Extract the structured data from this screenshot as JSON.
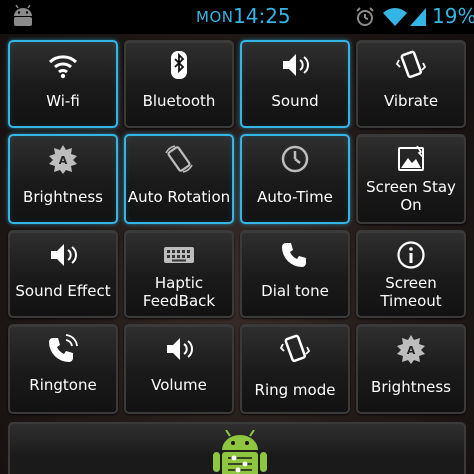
{
  "status_bar": {
    "day": "MON",
    "time": "14:25",
    "battery_percent": "19%",
    "accent_color": "#33b5e5",
    "icons": [
      "android-icon",
      "alarm-icon",
      "wifi-icon",
      "signal-icon"
    ]
  },
  "tiles": [
    {
      "label": "Wi-fi",
      "icon": "wifi-icon",
      "active": true
    },
    {
      "label": "Bluetooth",
      "icon": "bluetooth-icon",
      "active": false
    },
    {
      "label": "Sound",
      "icon": "speaker-icon",
      "active": true
    },
    {
      "label": "Vibrate",
      "icon": "vibrate-icon",
      "active": false
    },
    {
      "label": "Brightness",
      "icon": "brightness-icon",
      "active": true
    },
    {
      "label": "Auto Rotation",
      "icon": "rotate-icon",
      "active": true
    },
    {
      "label": "Auto-Time",
      "icon": "clock-icon",
      "active": true
    },
    {
      "label_line1": "Screen Stay",
      "label_line2": "On",
      "icon": "screen-stay-on-icon",
      "active": false
    },
    {
      "label": "Sound Effect",
      "icon": "speaker-icon",
      "active": false
    },
    {
      "label_line1": "Haptic",
      "label_line2": "FeedBack",
      "icon": "keyboard-icon",
      "active": false
    },
    {
      "label": "Dial tone",
      "icon": "phone-icon",
      "active": false
    },
    {
      "label_line1": "Screen",
      "label_line2": "Timeout",
      "icon": "info-icon",
      "active": false
    },
    {
      "label": "Ringtone",
      "icon": "phone-ring-icon",
      "active": false
    },
    {
      "label": "Volume",
      "icon": "speaker-icon",
      "active": false
    },
    {
      "label": "Ring mode",
      "icon": "vibrate-icon",
      "active": false
    },
    {
      "label": "Brightness",
      "icon": "brightness-icon",
      "active": false
    }
  ],
  "bottom_panel": {
    "icon": "android-settings-icon",
    "accent_color": "#8ec63f"
  }
}
